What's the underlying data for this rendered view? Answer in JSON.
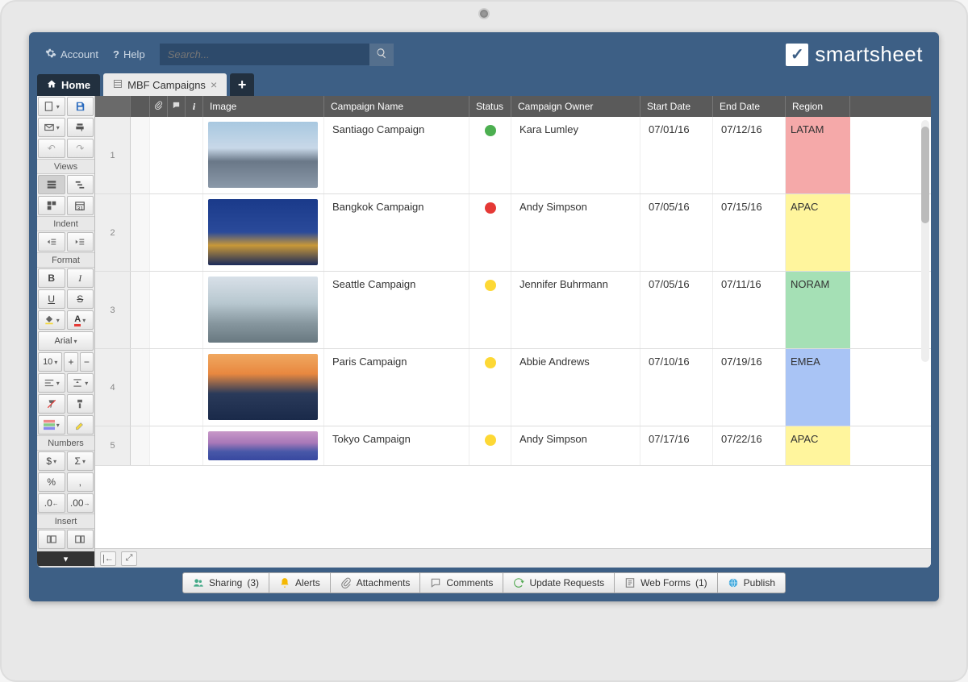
{
  "topbar": {
    "account": "Account",
    "help": "Help",
    "search_placeholder": "Search..."
  },
  "brand": "smartsheet",
  "tabs": {
    "home": "Home",
    "sheet": "MBF Campaigns"
  },
  "toolbar": {
    "views_label": "Views",
    "indent_label": "Indent",
    "format_label": "Format",
    "numbers_label": "Numbers",
    "insert_label": "Insert",
    "font_name": "Arial",
    "font_size": "10",
    "bold": "B",
    "italic": "I",
    "underline": "U",
    "strike": "S",
    "currency": "$",
    "sum": "Σ",
    "percent": "%",
    "comma": ",",
    "dec_dec": ".0",
    "dec_inc": ".00"
  },
  "columns": {
    "image": "Image",
    "campaign_name": "Campaign Name",
    "status": "Status",
    "owner": "Campaign Owner",
    "start": "Start Date",
    "end": "End Date",
    "region": "Region"
  },
  "rows": [
    {
      "num": "1",
      "campaign": "Santiago Campaign",
      "status_color": "#4caf50",
      "owner": "Kara Lumley",
      "start": "07/01/16",
      "end": "07/12/16",
      "region": "LATAM",
      "region_bg": "#f5a9a9",
      "img_css": "linear-gradient(180deg,#a8c8e0 0%,#c8d8e8 40%,#6a7888 60%,#8a98a8 100%)"
    },
    {
      "num": "2",
      "campaign": "Bangkok Campaign",
      "status_color": "#e53935",
      "owner": "Andy Simpson",
      "start": "07/05/16",
      "end": "07/15/16",
      "region": "APAC",
      "region_bg": "#fff59d",
      "img_css": "linear-gradient(180deg,#1a3a8a 0%,#2a4a9a 50%,#c89838 70%,#1a2a5a 100%)"
    },
    {
      "num": "3",
      "campaign": "Seattle Campaign",
      "status_color": "#fdd835",
      "owner": "Jennifer Buhrmann",
      "start": "07/05/16",
      "end": "07/11/16",
      "region": "NORAM",
      "region_bg": "#a5e0b5",
      "img_css": "linear-gradient(180deg,#d8e0e8 0%,#b8c8d0 40%,#8898a0 70%,#687880 100%)"
    },
    {
      "num": "4",
      "campaign": "Paris Campaign",
      "status_color": "#fdd835",
      "owner": "Abbie Andrews",
      "start": "07/10/16",
      "end": "07/19/16",
      "region": "EMEA",
      "region_bg": "#a9c4f5",
      "img_css": "linear-gradient(180deg,#f0a860 0%,#e88840 30%,#2a3a5a 60%,#1a2a4a 100%)"
    },
    {
      "num": "5",
      "campaign": "Tokyo Campaign",
      "status_color": "#fdd835",
      "owner": "Andy Simpson",
      "start": "07/17/16",
      "end": "07/22/16",
      "region": "APAC",
      "region_bg": "#fff59d",
      "img_css": "linear-gradient(180deg,#c898c8 0%,#a878b8 40%,#4858a8 70%,#3848a0 100%)"
    }
  ],
  "footer": {
    "sharing": "Sharing",
    "sharing_count": "(3)",
    "alerts": "Alerts",
    "attachments": "Attachments",
    "comments": "Comments",
    "update_requests": "Update Requests",
    "web_forms": "Web Forms",
    "web_forms_count": "(1)",
    "publish": "Publish"
  }
}
